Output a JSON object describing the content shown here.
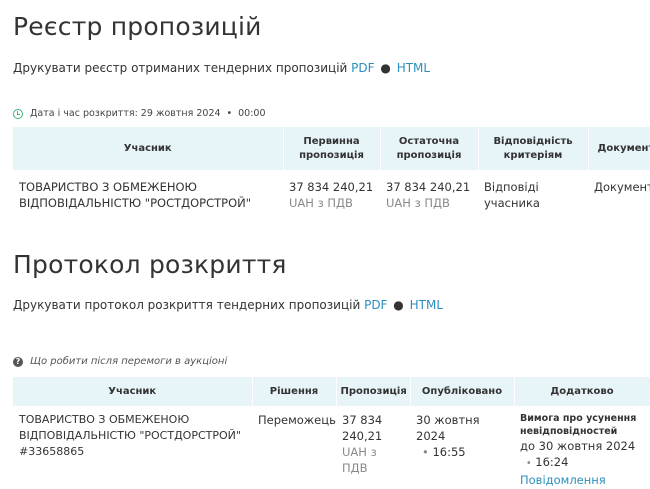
{
  "registry": {
    "title": "Реєстр пропозицій",
    "print_text": "Друкувати реєстр отриманих тендерних пропозицій",
    "pdf_label": "PDF",
    "bullet": "●",
    "html_label": "HTML",
    "opening_label": "Дата і час розкриття: 29 жовтня 2024",
    "opening_dot": "•",
    "opening_time": "00:00",
    "columns": {
      "participant": "Учасник",
      "initial": "Первинна пропозиція",
      "final": "Остаточна пропозиція",
      "compliance": "Відповідність критеріям",
      "documents": "Документи"
    },
    "row": {
      "participant": "ТОВАРИСТВО З ОБМЕЖЕНОЮ ВІДПОВІДАЛЬНІСТЮ \"РОСТДОРСТРОЙ\"",
      "initial_amount": "37 834 240,21",
      "initial_currency": "UAH з ПДВ",
      "final_amount": "37 834 240,21",
      "final_currency": "UAH з ПДВ",
      "compliance": "Відповіді учасника",
      "documents": "Документи"
    }
  },
  "protocol": {
    "title": "Протокол розкриття",
    "print_text": "Друкувати протокол розкриття тендерних пропозицій",
    "pdf_label": "PDF",
    "bullet": "●",
    "html_label": "HTML",
    "help_text": "Що робити після перемоги в аукціоні",
    "columns": {
      "participant": "Учасник",
      "decision": "Рішення",
      "proposal": "Пропозиція",
      "published": "Опубліковано",
      "additional": "Додатково"
    },
    "row": {
      "participant": "ТОВАРИСТВО З ОБМЕЖЕНОЮ ВІДПОВІДАЛЬНІСТЮ \"РОСТДОРСТРОЙ\"",
      "participant_id": "#33658865",
      "decision": "Переможець",
      "proposal_amount": "37 834 240,21",
      "proposal_currency": "UAH з ПДВ",
      "published_date": "30 жовтня 2024",
      "published_dot": "•",
      "published_time": "16:55",
      "requirement_title": "Вимога про усунення невідповідностей",
      "requirement_date": "до 30 жовтня 2024",
      "requirement_dot": "•",
      "requirement_time": "16:24",
      "notifications": "Повідомлення"
    }
  },
  "colors": {
    "link": "#2b8fbd",
    "header_bg": "#e7f4f8",
    "clock_icon": "#3cb371"
  }
}
